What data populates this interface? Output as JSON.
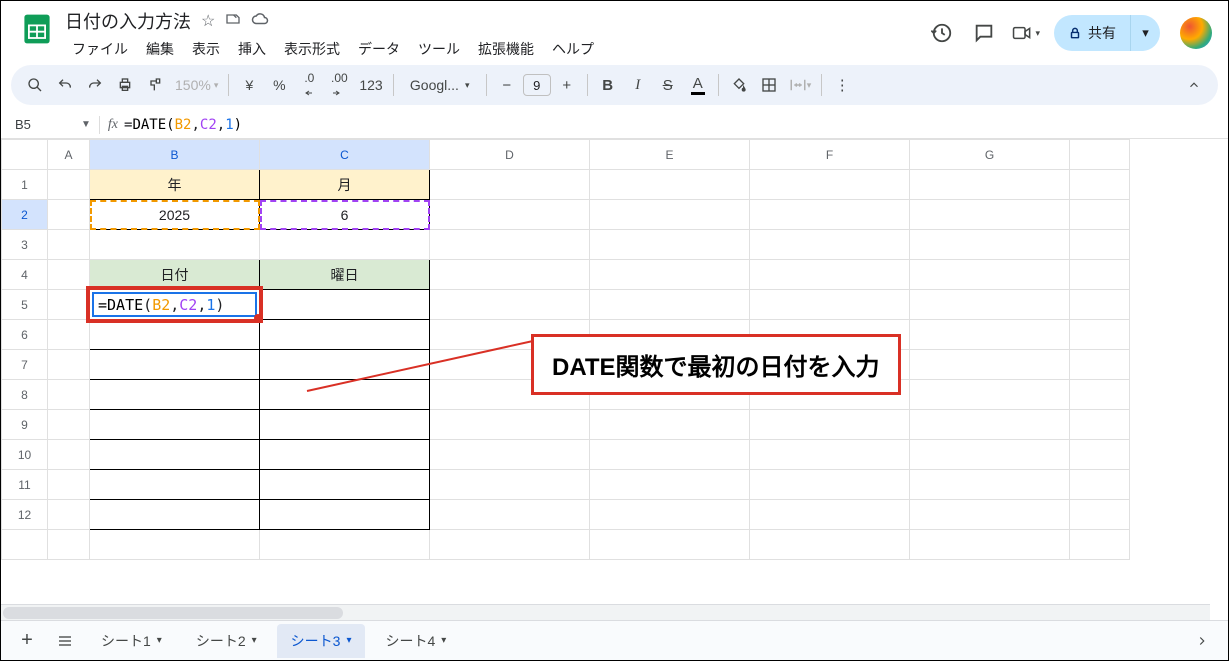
{
  "doc": {
    "title": "日付の入力方法"
  },
  "menu": {
    "file": "ファイル",
    "edit": "編集",
    "view": "表示",
    "insert": "挿入",
    "format": "表示形式",
    "data": "データ",
    "tools": "ツール",
    "ext": "拡張機能",
    "help": "ヘルプ"
  },
  "share": {
    "label": "共有"
  },
  "toolbar": {
    "zoom": "150%",
    "font": "Googl...",
    "fontsize": "9",
    "currency": "¥",
    "percent": "%",
    "dec_dec": ".0",
    "dec_inc": ".00",
    "num": "123"
  },
  "namebox": {
    "cell": "B5"
  },
  "formula": {
    "prefix": "=",
    "fn": "DATE",
    "lp": "(",
    "a1": "B2",
    "c1": ",",
    "a2": "C2",
    "c2": ",",
    "a3": "1",
    "rp": ")"
  },
  "columns": {
    "A": "A",
    "B": "B",
    "C": "C",
    "D": "D",
    "E": "E",
    "F": "F",
    "G": "G"
  },
  "rows": {
    "r1": "1",
    "r2": "2",
    "r3": "3",
    "r4": "4",
    "r5": "5",
    "r6": "6",
    "r7": "7",
    "r8": "8",
    "r9": "9",
    "r10": "10",
    "r11": "11",
    "r12": "12"
  },
  "cells": {
    "b1": "年",
    "c1": "月",
    "b2": "2025",
    "c2": "6",
    "b4": "日付",
    "c4": "曜日"
  },
  "callout": {
    "text": "DATE関数で最初の日付を入力"
  },
  "sheets": {
    "s1": "シート1",
    "s2": "シート2",
    "s3": "シート3",
    "s4": "シート4"
  }
}
